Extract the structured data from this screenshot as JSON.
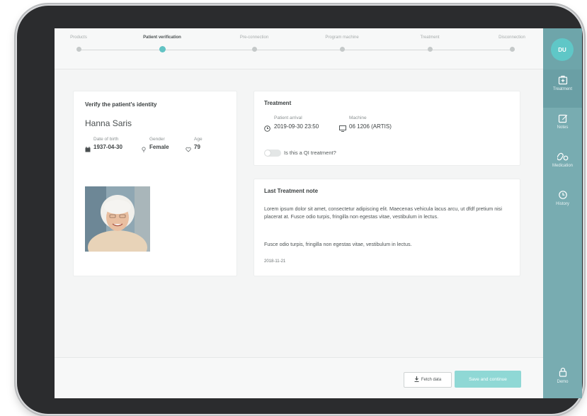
{
  "stepper": {
    "steps": [
      {
        "label": "Products",
        "active": false
      },
      {
        "label": "Patient verification",
        "active": true
      },
      {
        "label": "Pre-connection",
        "active": false
      },
      {
        "label": "Program machine",
        "active": false
      },
      {
        "label": "Treatment",
        "active": false
      },
      {
        "label": "Disconnection",
        "active": false
      }
    ]
  },
  "user": {
    "initials": "DU"
  },
  "rail": {
    "items": [
      {
        "label": "Treatment",
        "icon": "plus-box-icon"
      },
      {
        "label": "Notes",
        "icon": "edit-note-icon"
      },
      {
        "label": "Medication",
        "icon": "pills-icon"
      },
      {
        "label": "History",
        "icon": "history-icon"
      }
    ],
    "bottom_label": "Demo"
  },
  "identity": {
    "title": "Verify the patient's identity",
    "name": "Hanna Saris",
    "dob_label": "Date of birth",
    "dob_value": "1937-04-30",
    "gender_label": "Gender",
    "gender_value": "Female",
    "age_label": "Age",
    "age_value": "79"
  },
  "treatment": {
    "title": "Treatment",
    "arrival_label": "Patient arrival",
    "arrival_value": "2019-09-30 23:50",
    "machine_label": "Machine",
    "machine_value": "06 1206 (ARTIS)",
    "qi_label": "Is this a QI treatment?"
  },
  "note": {
    "title": "Last Treatment note",
    "paragraph1": "Lorem ipsum dolor sit amet, consectetur adipiscing elit. Maecenas vehicula lacus arcu, ut dfdf pretium nisi placerat at. Fusce odio turpis, fringilla non egestas vitae, vestibulum in lectus.",
    "paragraph2": "Fusce odio turpis, fringilla non egestas vitae, vestibulum in lectus.",
    "date": "2018-11-21"
  },
  "footer": {
    "fetch_label": "Fetch data",
    "save_label": "Save and continue"
  },
  "colors": {
    "accent": "#62c3c4",
    "rail": "#78acb1",
    "save_button": "#8fd8d5"
  }
}
